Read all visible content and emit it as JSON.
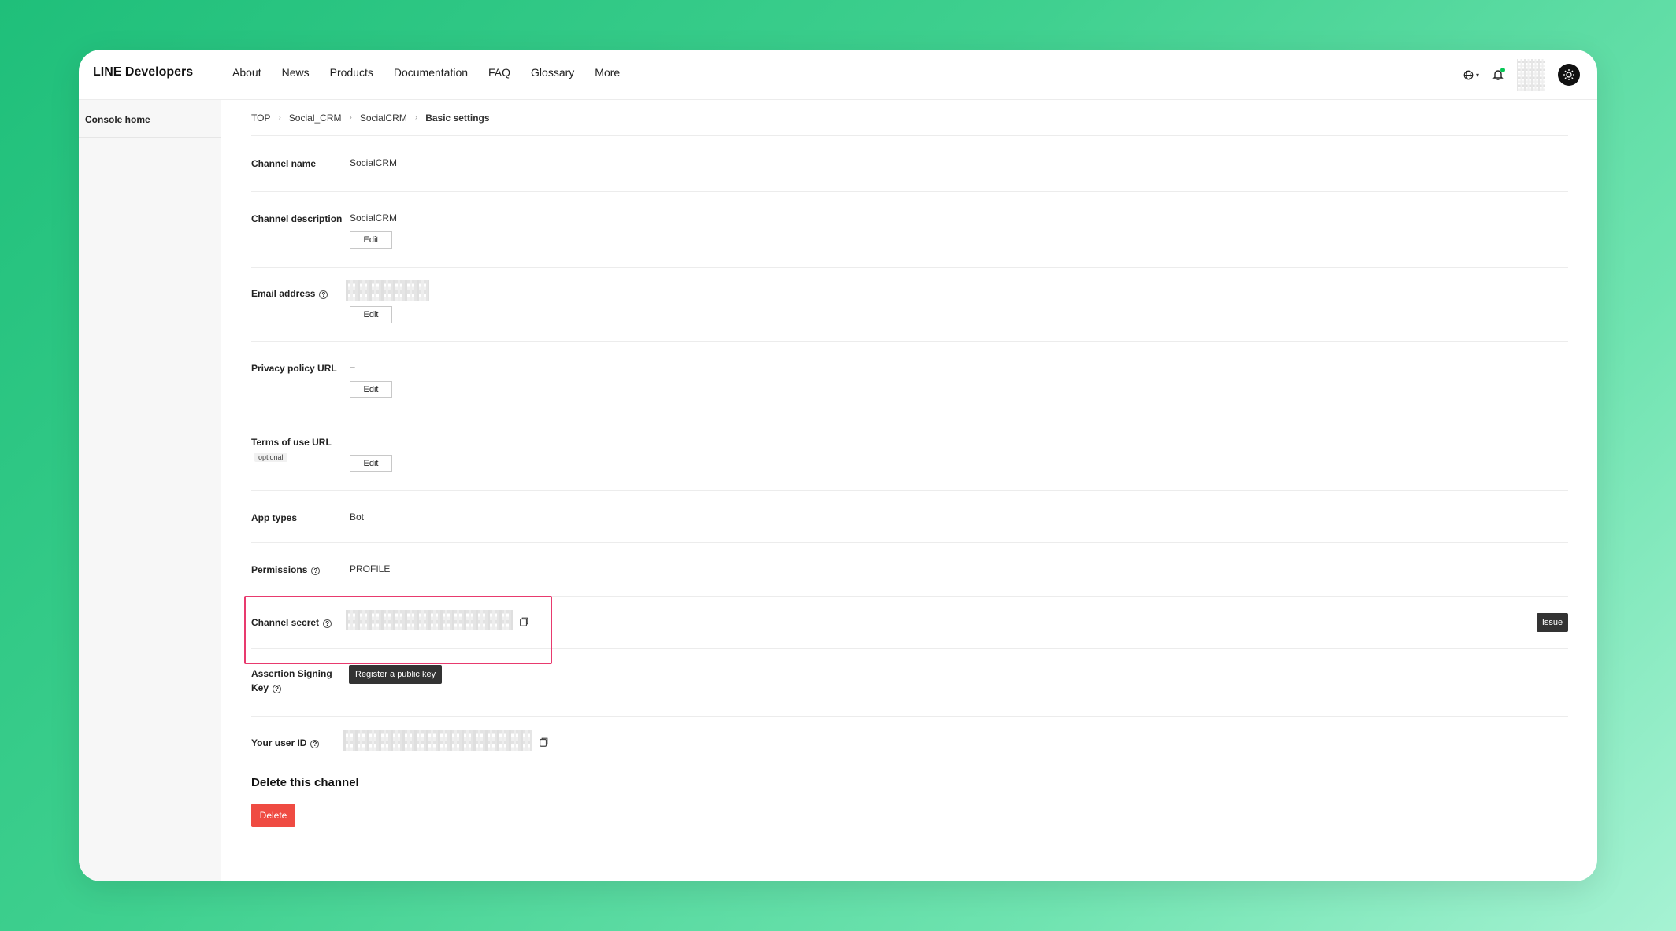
{
  "header": {
    "brand": "LINE Developers",
    "nav": [
      "About",
      "News",
      "Products",
      "Documentation",
      "FAQ",
      "Glossary",
      "More"
    ]
  },
  "sidebar": {
    "items": [
      {
        "label": "Console home"
      }
    ]
  },
  "breadcrumb": [
    "TOP",
    "Social_CRM",
    "SocialCRM",
    "Basic settings"
  ],
  "settings": {
    "channel_name": {
      "label": "Channel name",
      "value": "SocialCRM"
    },
    "channel_description": {
      "label": "Channel description",
      "value": "SocialCRM",
      "edit": "Edit"
    },
    "email": {
      "label": "Email address",
      "edit": "Edit"
    },
    "privacy_policy": {
      "label": "Privacy policy URL",
      "value": "–",
      "edit": "Edit"
    },
    "terms_of_use": {
      "label": "Terms of use URL",
      "badge": "optional",
      "edit": "Edit"
    },
    "app_types": {
      "label": "App types",
      "value": "Bot"
    },
    "permissions": {
      "label": "Permissions",
      "value": "PROFILE"
    },
    "channel_secret": {
      "label": "Channel secret",
      "issue": "Issue"
    },
    "assertion_key": {
      "label_line1": "Assertion Signing",
      "label_line2": "Key",
      "button": "Register a public key"
    },
    "user_id": {
      "label": "Your user ID"
    }
  },
  "danger": {
    "title": "Delete this channel",
    "button": "Delete"
  },
  "colors": {
    "accent": "#06c755",
    "highlight": "#e83a6e",
    "delete": "#ef4b42"
  }
}
